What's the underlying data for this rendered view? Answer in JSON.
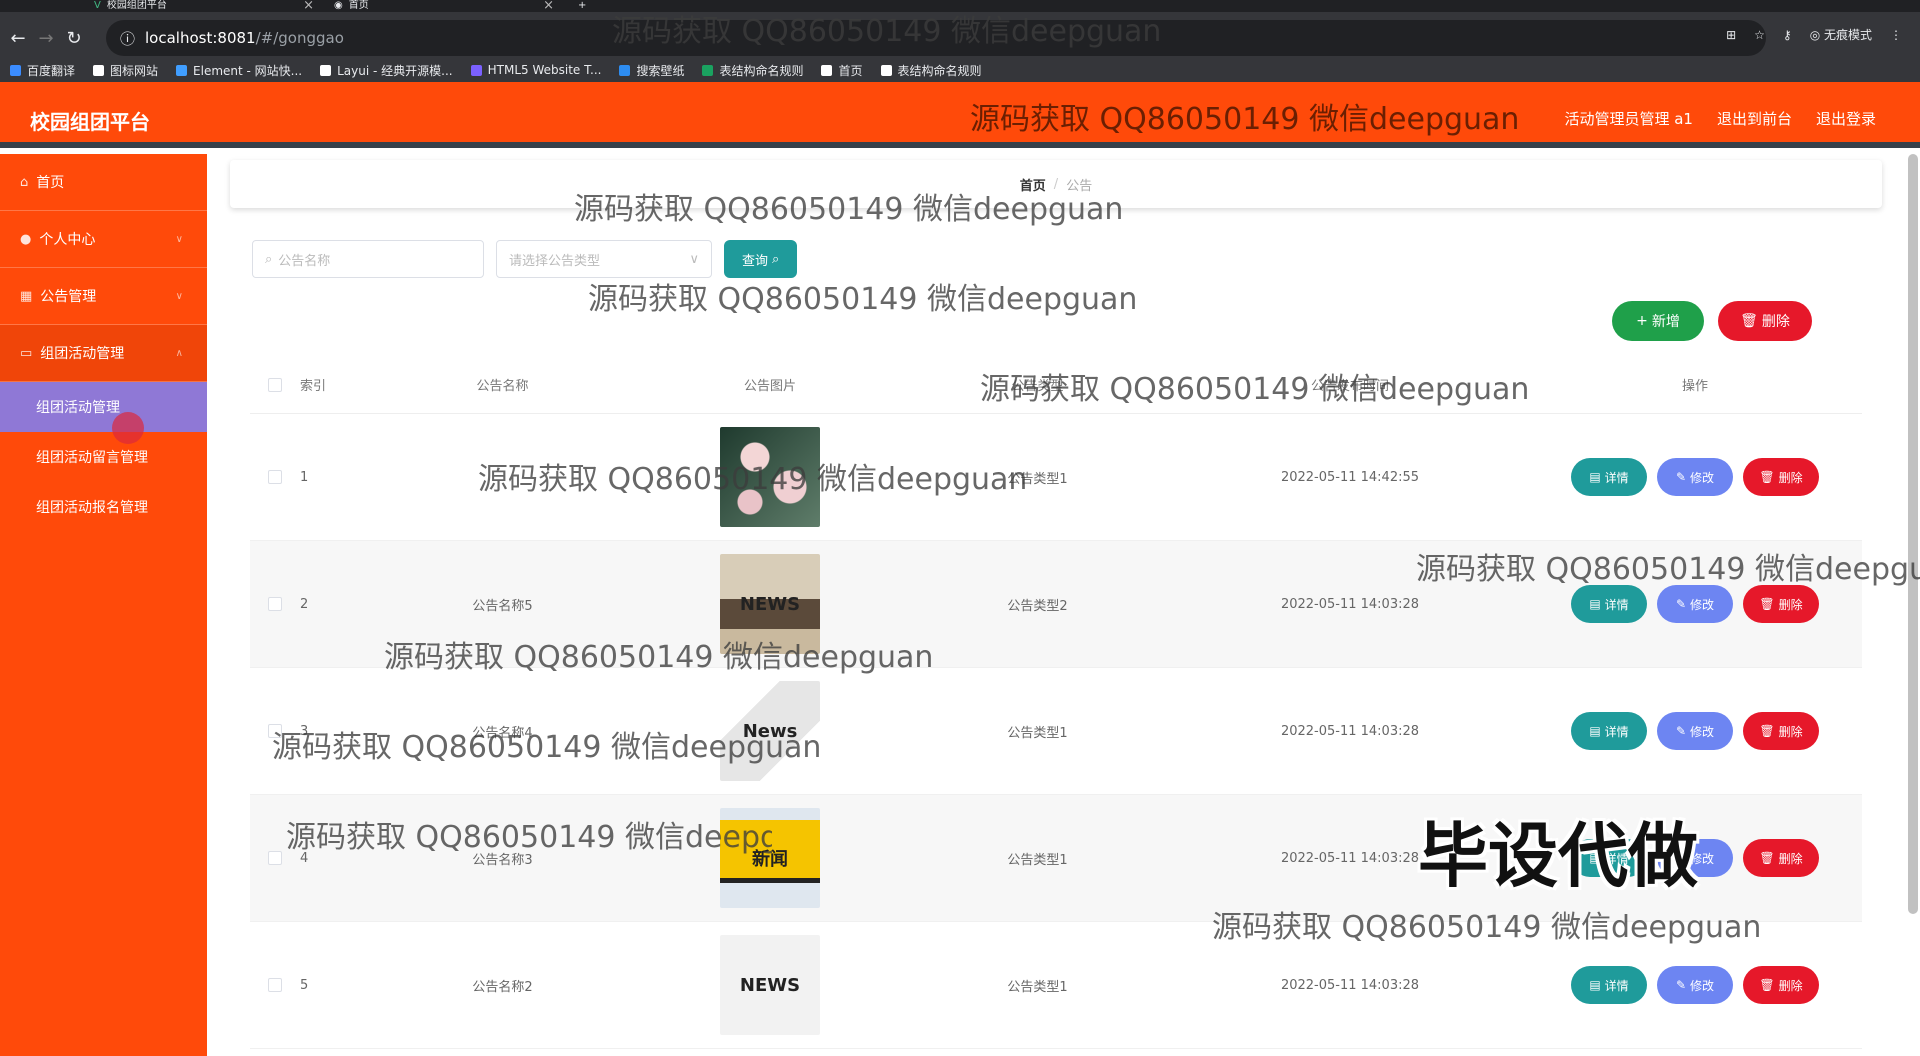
{
  "browser": {
    "tabs": [
      {
        "title": "校园组团平台"
      },
      {
        "title": "首页"
      }
    ],
    "url_host": "localhost:8081",
    "url_path": "/#/gonggao",
    "incognito_label": "无痕模式",
    "bookmarks": [
      {
        "label": "百度翻译",
        "color": "#3b8cff"
      },
      {
        "label": "图标网站",
        "color": "#ffffff"
      },
      {
        "label": "Element - 网站快...",
        "color": "#409eff"
      },
      {
        "label": "Layui - 经典开源模...",
        "color": "#ffffff"
      },
      {
        "label": "HTML5 Website T...",
        "color": "#7b61ff"
      },
      {
        "label": "搜索壁纸",
        "color": "#2d8cf0"
      },
      {
        "label": "表结构命名规则",
        "color": "#1aa260"
      },
      {
        "label": "首页",
        "color": "#ffffff"
      },
      {
        "label": "表结构命名规则",
        "color": "#ffffff"
      }
    ]
  },
  "header": {
    "brand": "校园组团平台",
    "links": [
      "活动管理员管理 a1",
      "退出到前台",
      "退出登录"
    ]
  },
  "sidebar": {
    "items": [
      {
        "label": "首页",
        "icon": "home-icon"
      },
      {
        "label": "个人中心",
        "icon": "user-icon"
      },
      {
        "label": "公告管理",
        "icon": "notice-icon"
      },
      {
        "label": "组团活动管理",
        "icon": "activity-icon"
      }
    ],
    "sub_items": [
      "组团活动管理",
      "组团活动留言管理",
      "组团活动报名管理"
    ]
  },
  "breadcrumb": {
    "home": "首页",
    "current": "公告"
  },
  "filter": {
    "name_placeholder": "公告名称",
    "type_placeholder": "请选择公告类型",
    "query_label": "查询"
  },
  "actions": {
    "add_label": "新增",
    "delete_label": "删除"
  },
  "table": {
    "headers": [
      "索引",
      "公告名称",
      "公告图片",
      "公告类型",
      "公告发布时间",
      "操作"
    ],
    "op_labels": {
      "detail": "详情",
      "edit": "修改",
      "delete": "删除"
    },
    "rows": [
      {
        "index": "1",
        "name": "",
        "type": "公告类型1",
        "time": "2022-05-11 14:42:55",
        "image": "roses"
      },
      {
        "index": "2",
        "name": "公告名称5",
        "type": "公告类型2",
        "time": "2022-05-11 14:03:28",
        "image": "news-blocks"
      },
      {
        "index": "3",
        "name": "公告名称4",
        "type": "公告类型1",
        "time": "2022-05-11 14:03:28",
        "image": "news-paper"
      },
      {
        "index": "4",
        "name": "公告名称3",
        "type": "公告类型1",
        "time": "2022-05-11 14:03:28",
        "image": "phone-news"
      },
      {
        "index": "5",
        "name": "公告名称2",
        "type": "公告类型1",
        "time": "2022-05-11 14:03:28",
        "image": "news-illustration"
      }
    ]
  },
  "watermark": {
    "text": "源码获取 QQ86050149 微信deepguan",
    "big_text": "毕设代做"
  },
  "colors": {
    "primary": "#ff4a0a",
    "teal": "#1f9b9b",
    "blue": "#6d85f2",
    "red": "#e6182a",
    "green": "#1fa04a"
  }
}
